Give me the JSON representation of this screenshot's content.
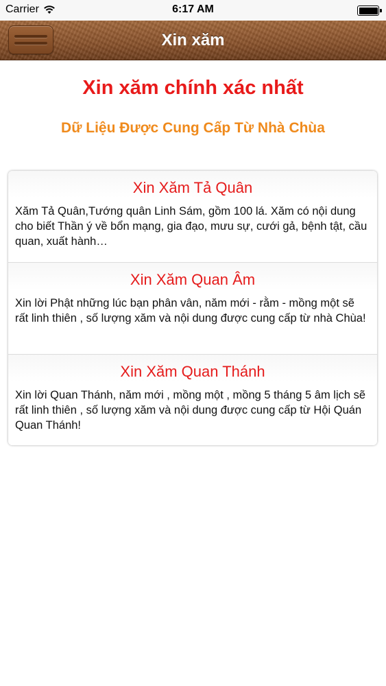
{
  "status_bar": {
    "carrier": "Carrier",
    "time": "6:17 AM",
    "battery_level": 1.0
  },
  "nav_bar": {
    "title": "Xin xăm",
    "menu_icon": "hamburger-menu-icon"
  },
  "header": {
    "title": "Xin xăm chính xác nhất",
    "subtitle": "Dữ Liệu Được Cung Cấp Từ Nhà Chùa"
  },
  "items": [
    {
      "title": "Xin Xăm Tả Quân",
      "description": "Xăm Tả Quân,Tướng quân Linh Sám, gồm 100 lá. Xăm có nội dung cho biết Thần ý về bổn mạng, gia đạo, mưu sự, cưới gả, bệnh tật, cầu quan, xuất hành…"
    },
    {
      "title": "Xin Xăm Quan Âm",
      "description": "Xin lời Phật những lúc bạn phân vân, năm mới - rằm - mồng một sẽ rất linh thiên , số lượng xăm và nội dung được cung cấp từ nhà Chùa!"
    },
    {
      "title": "Xin Xăm Quan Thánh",
      "description": "Xin lời Quan Thánh, năm mới , mồng một , mồng 5 tháng 5 âm lịch sẽ rất linh thiên , số lượng xăm và nội dung được cung cấp từ Hội Quán Quan Thánh!"
    }
  ],
  "colors": {
    "title_red": "#e81a1a",
    "subtitle_orange": "#ef8a1c",
    "nav_brown": "#8a522b"
  }
}
